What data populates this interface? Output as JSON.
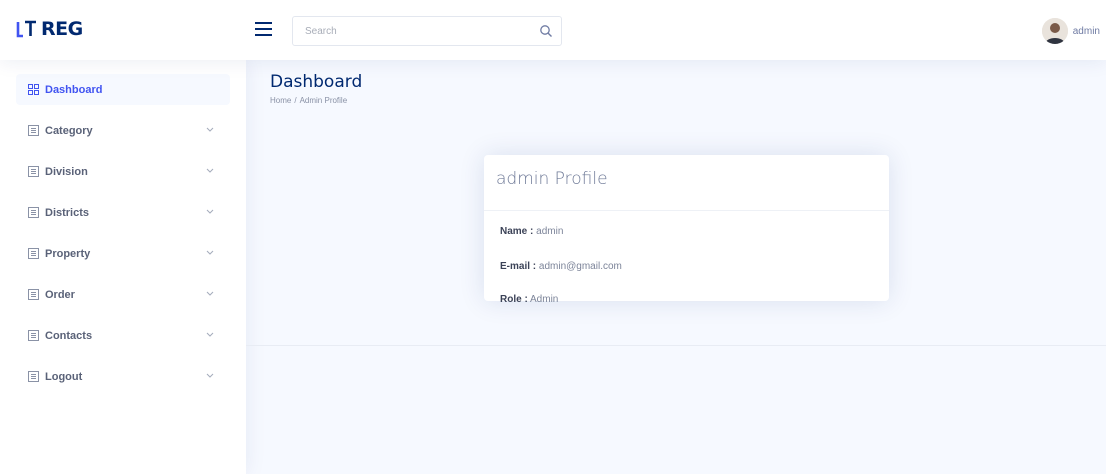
{
  "brand": {
    "logo_text": "REG"
  },
  "colors": {
    "primary": "#012970",
    "accent": "#4154f1",
    "background": "#f6f9ff"
  },
  "search": {
    "placeholder": "Search",
    "icon": "search-icon"
  },
  "user": {
    "name": "admin"
  },
  "sidebar": {
    "items": [
      {
        "label": "Dashboard",
        "icon": "grid-icon",
        "active": true
      },
      {
        "label": "Category",
        "icon": "menu-icon",
        "chevron": "chevron-down-icon"
      },
      {
        "label": "Division",
        "icon": "menu-icon",
        "chevron": "chevron-down-icon"
      },
      {
        "label": "Districts",
        "icon": "menu-icon",
        "chevron": "chevron-down-icon"
      },
      {
        "label": "Property",
        "icon": "menu-icon",
        "chevron": "chevron-down-icon"
      },
      {
        "label": "Order",
        "icon": "menu-icon",
        "chevron": "chevron-down-icon"
      },
      {
        "label": "Contacts",
        "icon": "menu-icon",
        "chevron": "chevron-down-icon"
      },
      {
        "label": "Logout",
        "icon": "menu-icon",
        "chevron": "chevron-down-icon"
      }
    ]
  },
  "page": {
    "title": "Dashboard",
    "breadcrumb": {
      "home": "Home",
      "separator": "/",
      "current": "Admin Profile"
    }
  },
  "profile_card": {
    "title": "admin Profile",
    "fields": [
      {
        "label": "Name :",
        "value": "admin"
      },
      {
        "label": "E-mail :",
        "value": "admin@gmail.com"
      },
      {
        "label": "Role :",
        "value": "Admin"
      }
    ]
  }
}
